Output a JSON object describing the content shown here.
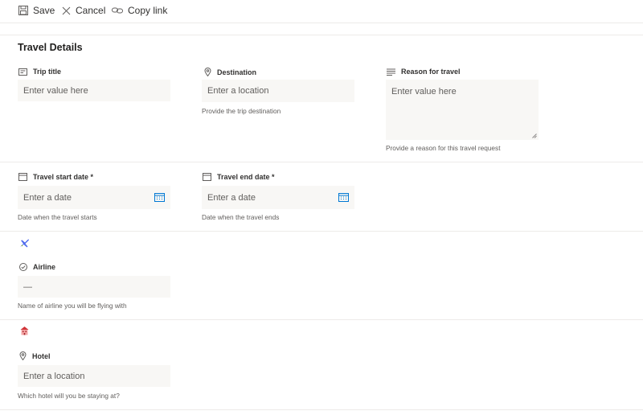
{
  "toolbar": {
    "save_label": "Save",
    "cancel_label": "Cancel",
    "copy_link_label": "Copy link"
  },
  "section": {
    "title": "Travel Details"
  },
  "fields": {
    "trip_title": {
      "label": "Trip title",
      "placeholder": "Enter value here"
    },
    "destination": {
      "label": "Destination",
      "placeholder": "Enter a location",
      "help": "Provide the trip destination"
    },
    "reason": {
      "label": "Reason for travel",
      "placeholder": "Enter value here",
      "help": "Provide a reason for this travel request"
    },
    "start_date": {
      "label": "Travel start date *",
      "placeholder": "Enter a date",
      "help": "Date when the travel starts"
    },
    "end_date": {
      "label": "Travel end date *",
      "placeholder": "Enter a date",
      "help": "Date when the travel ends"
    },
    "airline": {
      "label": "Airline",
      "value": "—",
      "help": "Name of airline you will be flying with"
    },
    "hotel": {
      "label": "Hotel",
      "placeholder": "Enter a location",
      "help": "Which hotel will you be staying at?"
    }
  },
  "groups": {
    "flight_icon": "airplane-icon",
    "hotel_icon": "hotel-icon"
  }
}
